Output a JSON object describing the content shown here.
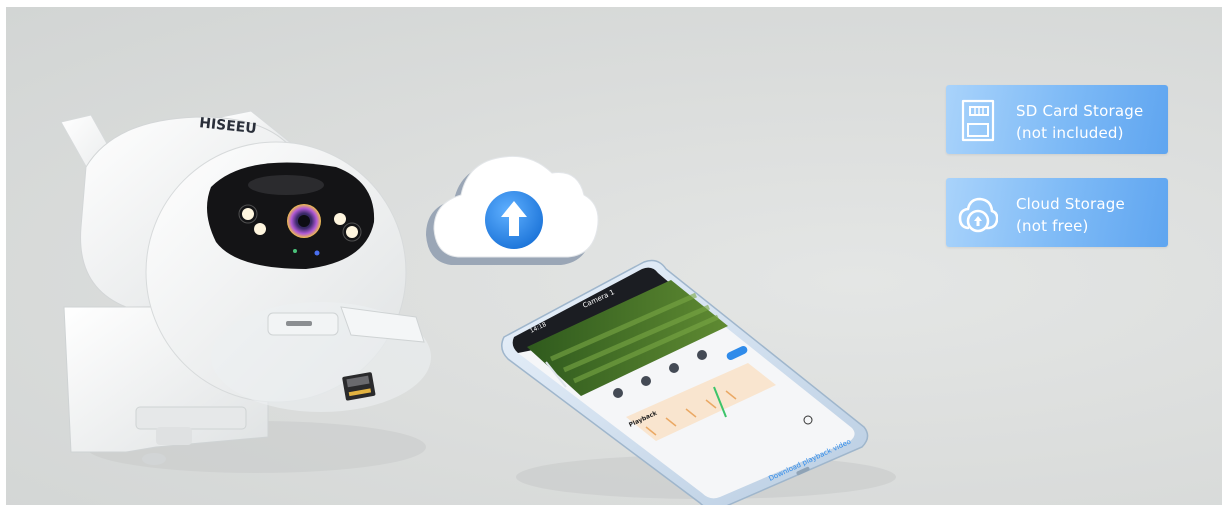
{
  "brand": {
    "logo_text": "HISEEU"
  },
  "storage_options": [
    {
      "icon": "sd-card-icon",
      "title": "SD Card Storage",
      "note": "(not included)"
    },
    {
      "icon": "cloud-upload-icon",
      "title": "Cloud Storage",
      "note": "(not free)"
    }
  ],
  "phone_app": {
    "time": "14:18",
    "camera_title": "Camera 1",
    "section": "Playback",
    "action": "Download playback video"
  },
  "colors": {
    "badge_light": "#a9d3fb",
    "badge_dark": "#5fa5f0",
    "accent_blue": "#2f8bea",
    "background": "#dcdedd"
  }
}
